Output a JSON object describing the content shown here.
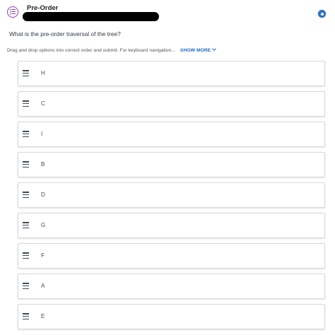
{
  "header": {
    "title": "Pre-Order",
    "icon": "question-list-icon",
    "accent": "#8a3fb3"
  },
  "question": {
    "text": "What is the pre-order  traversal of the tree?"
  },
  "instructions": {
    "text": "Drag and drop options into correct order and submit. For keyboard navigation...",
    "show_more": "SHOW MORE"
  },
  "options": [
    {
      "label": "H"
    },
    {
      "label": "C"
    },
    {
      "label": "I"
    },
    {
      "label": "B"
    },
    {
      "label": "D"
    },
    {
      "label": "G"
    },
    {
      "label": "F"
    },
    {
      "label": "A"
    },
    {
      "label": "E"
    }
  ],
  "colors": {
    "link": "#1f68c7",
    "corner_button": "#2c6fbf",
    "text": "#2d3b45"
  }
}
